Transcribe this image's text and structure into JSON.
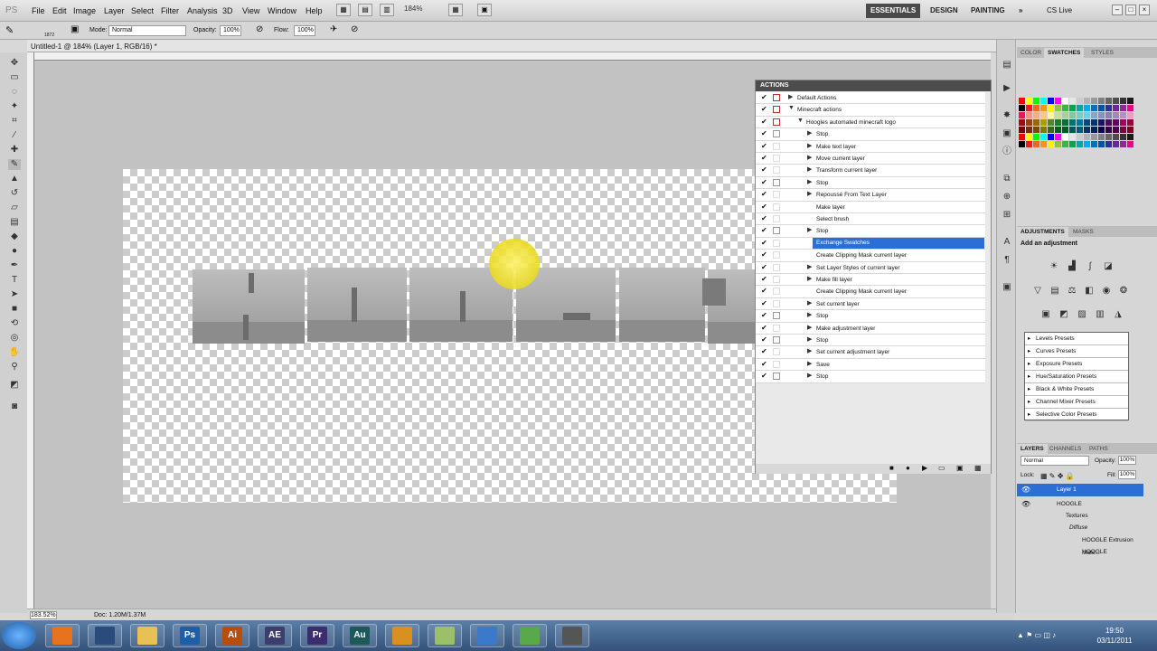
{
  "app": {
    "logo": "PS"
  },
  "menu": [
    "File",
    "Edit",
    "Image",
    "Layer",
    "Select",
    "Filter",
    "Analysis",
    "3D",
    "View",
    "Window",
    "Help"
  ],
  "zoom_menu": "184%",
  "workspaces": {
    "essentials": "ESSENTIALS",
    "design": "DESIGN",
    "painting": "PAINTING",
    "more": "»",
    "cslive": "CS Live"
  },
  "options": {
    "mode_label": "Mode:",
    "mode_value": "Normal",
    "opacity_label": "Opacity:",
    "opacity_value": "100%",
    "flow_label": "Flow:",
    "flow_value": "100%",
    "brush_size": "1872"
  },
  "document": {
    "tab_title": "Untitled-1 @ 184% (Layer 1, RGB/16) *",
    "zoom": "183.52%",
    "info": "Doc: 1.20M/1.37M"
  },
  "actions_panel": {
    "title": "ACTIONS",
    "rows": [
      {
        "label": "Default Actions",
        "level": 0,
        "box": "red",
        "tri": "▶"
      },
      {
        "label": "Minecraft actions",
        "level": 0,
        "box": "red",
        "tri": "▼"
      },
      {
        "label": "Hoogles automated minecraft logo",
        "level": 1,
        "box": "red",
        "tri": "▼"
      },
      {
        "label": "Stop",
        "level": 2,
        "box": "dialog",
        "tri": "▶"
      },
      {
        "label": "Make text layer",
        "level": 2,
        "box": "",
        "tri": "▶"
      },
      {
        "label": "Move current layer",
        "level": 2,
        "box": "",
        "tri": "▶"
      },
      {
        "label": "Transform current layer",
        "level": 2,
        "box": "",
        "tri": "▶"
      },
      {
        "label": "Stop",
        "level": 2,
        "box": "dialog",
        "tri": "▶"
      },
      {
        "label": "Repoussé From Text Layer",
        "level": 2,
        "box": "",
        "tri": "▶"
      },
      {
        "label": "Make layer",
        "level": 2,
        "box": "",
        "tri": ""
      },
      {
        "label": "Select brush",
        "level": 2,
        "box": "",
        "tri": ""
      },
      {
        "label": "Stop",
        "level": 2,
        "box": "dialog",
        "tri": "▶"
      },
      {
        "label": "Exchange Swatches",
        "level": 2,
        "box": "",
        "tri": "",
        "selected": true
      },
      {
        "label": "Create Clipping Mask current layer",
        "level": 2,
        "box": "",
        "tri": ""
      },
      {
        "label": "Set Layer Styles of current layer",
        "level": 2,
        "box": "",
        "tri": "▶"
      },
      {
        "label": "Make fill layer",
        "level": 2,
        "box": "",
        "tri": "▶"
      },
      {
        "label": "Create Clipping Mask current layer",
        "level": 2,
        "box": "",
        "tri": ""
      },
      {
        "label": "Set current layer",
        "level": 2,
        "box": "",
        "tri": "▶"
      },
      {
        "label": "Stop",
        "level": 2,
        "box": "dialog",
        "tri": "▶"
      },
      {
        "label": "Make adjustment layer",
        "level": 2,
        "box": "",
        "tri": "▶"
      },
      {
        "label": "Stop",
        "level": 2,
        "box": "dialog",
        "tri": "▶"
      },
      {
        "label": "Set current adjustment layer",
        "level": 2,
        "box": "",
        "tri": "▶"
      },
      {
        "label": "Save",
        "level": 2,
        "box": "",
        "tri": "▶"
      },
      {
        "label": "Stop",
        "level": 2,
        "box": "dialog",
        "tri": "▶"
      }
    ]
  },
  "swatches_tabs": [
    "COLOR",
    "SWATCHES",
    "STYLES"
  ],
  "adjustments": {
    "tabs": [
      "ADJUSTMENTS",
      "MASKS"
    ],
    "title": "Add an adjustment",
    "presets": [
      "Levels Presets",
      "Curves Presets",
      "Exposure Presets",
      "Hue/Saturation Presets",
      "Black & White Presets",
      "Channel Mixer Presets",
      "Selective Color Presets"
    ]
  },
  "layers": {
    "tabs": [
      "LAYERS",
      "CHANNELS",
      "PATHS"
    ],
    "blend_mode": "Normal",
    "opacity_label": "Opacity:",
    "opacity": "100%",
    "lock_label": "Lock:",
    "fill_label": "Fill:",
    "fill": "100%",
    "items": [
      {
        "name": "Layer 1",
        "selected": true
      },
      {
        "name": "HOOGLE"
      },
      {
        "name": "Textures"
      },
      {
        "name": "Diffuse"
      },
      {
        "name": "HOOGLE Extrusion Mate..."
      },
      {
        "name": "HOOGLE"
      }
    ]
  },
  "taskbar": {
    "apps": [
      {
        "name": "firefox",
        "label": "",
        "color": "#e8731c"
      },
      {
        "name": "cinema4d",
        "label": "",
        "color": "#2b4b7c"
      },
      {
        "name": "explorer",
        "label": "",
        "color": "#e8c055"
      },
      {
        "name": "photoshop",
        "label": "Ps",
        "color": "#1f5fa8"
      },
      {
        "name": "illustrator",
        "label": "Ai",
        "color": "#b84d10"
      },
      {
        "name": "aftereffects",
        "label": "AE",
        "color": "#3c3f6e"
      },
      {
        "name": "premiere",
        "label": "Pr",
        "color": "#3c2e6e"
      },
      {
        "name": "audition",
        "label": "Au",
        "color": "#1c5a5a"
      },
      {
        "name": "outlook",
        "label": "",
        "color": "#d89020"
      },
      {
        "name": "notes",
        "label": "",
        "color": "#9cc06a"
      },
      {
        "name": "itunes",
        "label": "",
        "color": "#3a7ac8"
      },
      {
        "name": "network",
        "label": "",
        "color": "#58a84c"
      },
      {
        "name": "tool",
        "label": "",
        "color": "#555555"
      }
    ],
    "time": "19:50",
    "date": "03/11/2011"
  }
}
